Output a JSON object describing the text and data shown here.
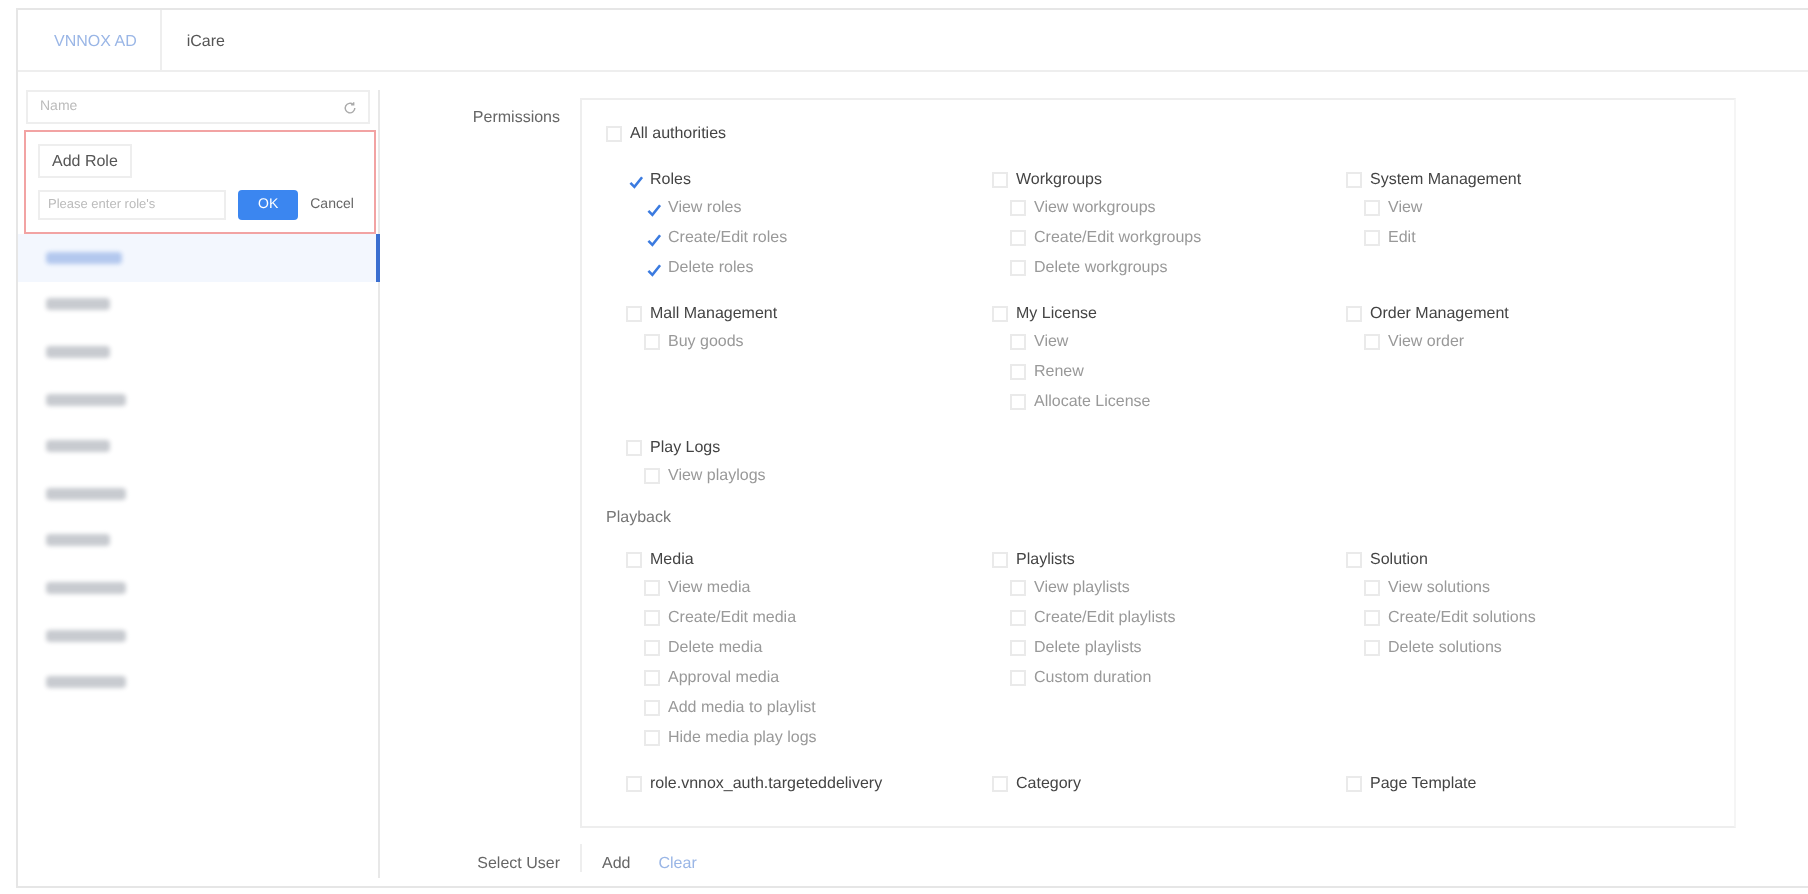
{
  "tabs": [
    {
      "label": "VNNOX AD",
      "selected": true
    },
    {
      "label": "iCare",
      "selected": false
    }
  ],
  "sidebar": {
    "search": {
      "placeholder": "Name"
    },
    "popover": {
      "add_button": "Add Role",
      "input": {
        "placeholder": "Please enter role's"
      },
      "ok": "OK",
      "cancel": "Cancel"
    },
    "items": [
      {
        "selected": true
      },
      {
        "selected": false
      },
      {
        "selected": false
      },
      {
        "selected": false
      },
      {
        "selected": false
      },
      {
        "selected": false
      },
      {
        "selected": false
      },
      {
        "selected": false
      },
      {
        "selected": false
      },
      {
        "selected": false
      }
    ]
  },
  "permissions": {
    "label": "Permissions",
    "all": {
      "label": "All authorities",
      "checked": false
    },
    "sections": [
      {
        "groups": [
          {
            "label": "Roles",
            "checked": true,
            "items": [
              {
                "label": "View roles",
                "checked": true
              },
              {
                "label": "Create/Edit roles",
                "checked": true
              },
              {
                "label": "Delete roles",
                "checked": true
              }
            ]
          },
          {
            "label": "Workgroups",
            "checked": false,
            "items": [
              {
                "label": "View workgroups",
                "checked": false
              },
              {
                "label": "Create/Edit workgroups",
                "checked": false
              },
              {
                "label": "Delete workgroups",
                "checked": false
              }
            ]
          },
          {
            "label": "System Management",
            "checked": false,
            "items": [
              {
                "label": "View",
                "checked": false
              },
              {
                "label": "Edit",
                "checked": false
              }
            ]
          },
          {
            "label": "Mall Management",
            "checked": false,
            "items": [
              {
                "label": "Buy goods",
                "checked": false
              }
            ]
          },
          {
            "label": "My License",
            "checked": false,
            "items": [
              {
                "label": "View",
                "checked": false
              },
              {
                "label": "Renew",
                "checked": false
              },
              {
                "label": "Allocate License",
                "checked": false
              }
            ]
          },
          {
            "label": "Order Management",
            "checked": false,
            "items": [
              {
                "label": "View order",
                "checked": false
              }
            ]
          },
          {
            "label": "Play Logs",
            "checked": false,
            "items": [
              {
                "label": "View playlogs",
                "checked": false
              }
            ]
          }
        ]
      },
      {
        "title": "Playback",
        "groups": [
          {
            "label": "Media",
            "checked": false,
            "items": [
              {
                "label": "View media",
                "checked": false
              },
              {
                "label": "Create/Edit media",
                "checked": false
              },
              {
                "label": "Delete media",
                "checked": false
              },
              {
                "label": "Approval media",
                "checked": false
              },
              {
                "label": "Add media to playlist",
                "checked": false
              },
              {
                "label": "Hide media play logs",
                "checked": false
              }
            ]
          },
          {
            "label": "Playlists",
            "checked": false,
            "items": [
              {
                "label": "View playlists",
                "checked": false
              },
              {
                "label": "Create/Edit playlists",
                "checked": false
              },
              {
                "label": "Delete playlists",
                "checked": false
              },
              {
                "label": "Custom duration",
                "checked": false
              }
            ]
          },
          {
            "label": "Solution",
            "checked": false,
            "items": [
              {
                "label": "View solutions",
                "checked": false
              },
              {
                "label": "Create/Edit solutions",
                "checked": false
              },
              {
                "label": "Delete solutions",
                "checked": false
              }
            ]
          },
          {
            "label": "role.vnnox_auth.targeteddelivery",
            "checked": false
          },
          {
            "label": "Category",
            "checked": false
          },
          {
            "label": "Page Template",
            "checked": false
          }
        ]
      }
    ]
  },
  "select_user": {
    "label": "Select User",
    "add": "Add",
    "clear": "Clear"
  }
}
